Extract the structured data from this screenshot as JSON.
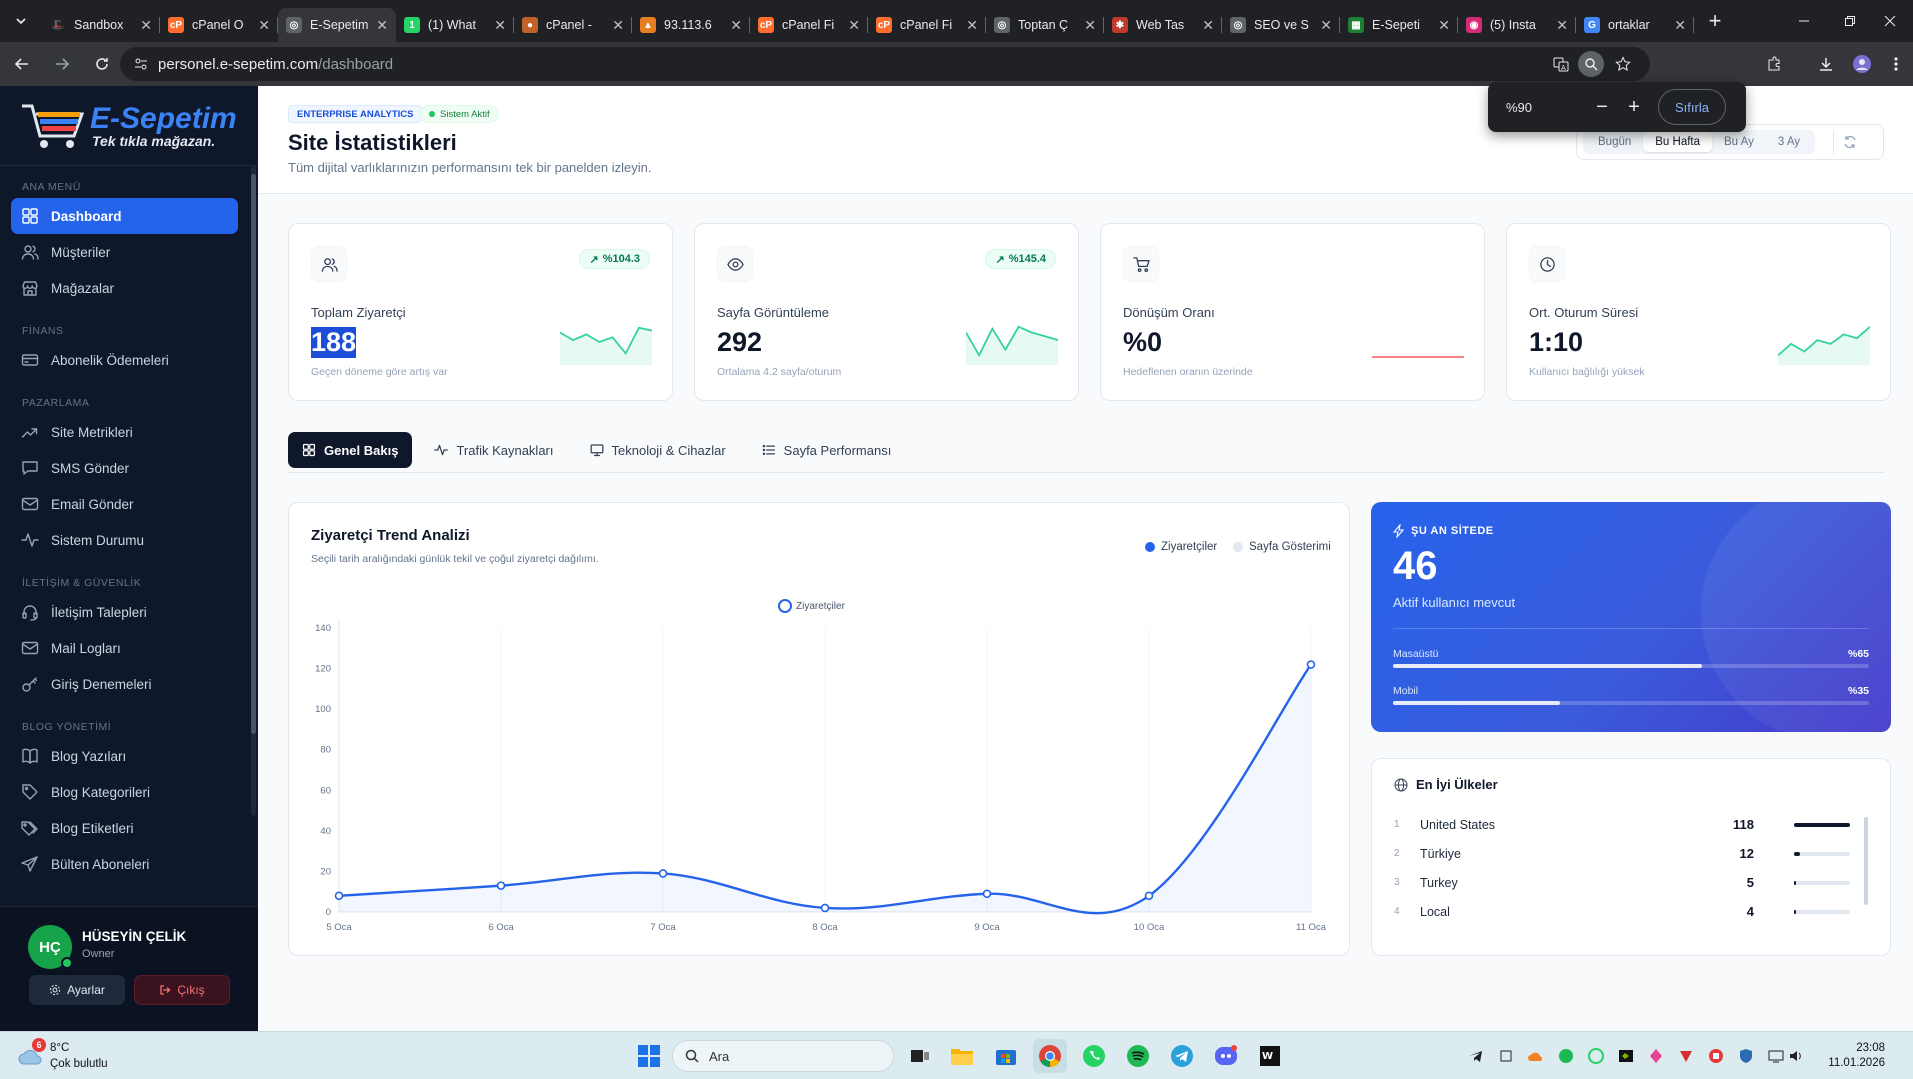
{
  "browser": {
    "tabs": [
      {
        "title": "Sandbox",
        "fav_color": "#202124",
        "fav_text": "🎩"
      },
      {
        "title": "cPanel O",
        "fav_color": "#ff6c2c",
        "fav_text": "cP"
      },
      {
        "title": "E-Sepetim",
        "fav_color": "#5f6368",
        "fav_text": "◎",
        "active": true
      },
      {
        "title": "(1) What",
        "fav_color": "#25d366",
        "fav_text": "1"
      },
      {
        "title": "cPanel -",
        "fav_color": "#c0632a",
        "fav_text": "●"
      },
      {
        "title": "93.113.6",
        "fav_color": "#e67e22",
        "fav_text": "▲"
      },
      {
        "title": "cPanel Fi",
        "fav_color": "#ff6c2c",
        "fav_text": "cP"
      },
      {
        "title": "cPanel Fi",
        "fav_color": "#ff6c2c",
        "fav_text": "cP"
      },
      {
        "title": "Toptan Ç",
        "fav_color": "#5f6368",
        "fav_text": "◎"
      },
      {
        "title": "Web Tas",
        "fav_color": "#c0392b",
        "fav_text": "✱"
      },
      {
        "title": "SEO ve S",
        "fav_color": "#5f6368",
        "fav_text": "◎"
      },
      {
        "title": "E-Sepeti",
        "fav_color": "#1e7e34",
        "fav_text": "▦"
      },
      {
        "title": "(5) Insta",
        "fav_color": "#d62976",
        "fav_text": "◉"
      },
      {
        "title": "ortaklar",
        "fav_color": "#4285f4",
        "fav_text": "G"
      }
    ],
    "url_host": "personel.e-sepetim.com",
    "url_path": "/dashboard",
    "zoom": {
      "value": "%90",
      "reset_label": "Sıfırla"
    }
  },
  "sidebar": {
    "brand": "E-Sepetim",
    "tagline": "Tek tıkla mağazan.",
    "sections": [
      {
        "title": "ANA MENÜ",
        "items": [
          {
            "label": "Dashboard",
            "icon": "grid-icon",
            "active": true
          },
          {
            "label": "Müşteriler",
            "icon": "users-icon"
          },
          {
            "label": "Mağazalar",
            "icon": "store-icon"
          }
        ]
      },
      {
        "title": "FİNANS",
        "items": [
          {
            "label": "Abonelik Ödemeleri",
            "icon": "card-icon"
          }
        ]
      },
      {
        "title": "PAZARLAMA",
        "items": [
          {
            "label": "Site Metrikleri",
            "icon": "trend-icon"
          },
          {
            "label": "SMS Gönder",
            "icon": "message-icon"
          },
          {
            "label": "Email Gönder",
            "icon": "mail-icon"
          },
          {
            "label": "Sistem Durumu",
            "icon": "pulse-icon"
          }
        ]
      },
      {
        "title": "İLETİŞİM & GÜVENLİK",
        "items": [
          {
            "label": "İletişim Talepleri",
            "icon": "headset-icon"
          },
          {
            "label": "Mail Logları",
            "icon": "mail-icon"
          },
          {
            "label": "Giriş Denemeleri",
            "icon": "key-icon"
          }
        ]
      },
      {
        "title": "BLOG YÖNETİMİ",
        "items": [
          {
            "label": "Blog Yazıları",
            "icon": "book-icon"
          },
          {
            "label": "Blog Kategorileri",
            "icon": "tag-icon"
          },
          {
            "label": "Blog Etiketleri",
            "icon": "tags-icon"
          },
          {
            "label": "Bülten Aboneleri",
            "icon": "send-icon"
          }
        ]
      }
    ],
    "user": {
      "initials": "HÇ",
      "name": "HÜSEYİN ÇELİK",
      "role": "Owner",
      "settings_label": "Ayarlar",
      "logout_label": "Çıkış"
    }
  },
  "header": {
    "badge": "ENTERPRISE ANALYTICS",
    "status": "Sistem Aktif",
    "title": "Site İstatistikleri",
    "subtitle": "Tüm dijital varlıklarınızın performansını tek bir panelden izleyin.",
    "ranges": [
      "Bugün",
      "Bu Hafta",
      "Bu Ay",
      "3 Ay"
    ],
    "active_range": "Bu Hafta"
  },
  "stats": [
    {
      "label": "Toplam Ziyaretçi",
      "value": "188",
      "note": "Geçen döneme göre artış var",
      "delta": "%104.3",
      "icon": "users-icon",
      "spark": [
        30,
        22,
        28,
        20,
        25,
        8,
        35,
        32
      ],
      "spark_color": "#34d399"
    },
    {
      "label": "Sayfa Görüntüleme",
      "value": "292",
      "note": "Ortalama 4.2 sayfa/oturum",
      "delta": "%145.4",
      "icon": "eye-icon",
      "spark": [
        30,
        6,
        34,
        12,
        36,
        30,
        26,
        22
      ],
      "spark_color": "#34d399"
    },
    {
      "label": "Dönüşüm Oranı",
      "value": "%0",
      "note": "Hedeflenen oranın üzerinde",
      "delta": "",
      "icon": "cart-icon",
      "spark": [
        0,
        0,
        0,
        0,
        0,
        0,
        0,
        0
      ],
      "spark_color": "#f87171"
    },
    {
      "label": "Ort. Oturum Süresi",
      "value": "1:10",
      "note": "Kullanıcı bağlılığı yüksek",
      "delta": "",
      "icon": "clock-icon",
      "spark": [
        6,
        18,
        10,
        22,
        18,
        28,
        24,
        36
      ],
      "spark_color": "#34d399"
    }
  ],
  "tabs": [
    {
      "label": "Genel Bakış",
      "icon": "grid-icon",
      "active": true
    },
    {
      "label": "Trafik Kaynakları",
      "icon": "pulse-icon"
    },
    {
      "label": "Teknoloji & Cihazlar",
      "icon": "monitor-icon"
    },
    {
      "label": "Sayfa Performansı",
      "icon": "list-icon"
    }
  ],
  "trend": {
    "title": "Ziyaretçi Trend Analizi",
    "subtitle": "Seçili tarih aralığındaki günlük tekil ve çoğul ziyaretçi dağılımı.",
    "legend": [
      {
        "name": "Ziyaretçiler",
        "color": "#2563eb"
      },
      {
        "name": "Sayfa Gösterimi",
        "color": "#e2e8f0"
      }
    ]
  },
  "chart_data": {
    "type": "line",
    "x": [
      "5 Oca",
      "6 Oca",
      "7 Oca",
      "8 Oca",
      "9 Oca",
      "10 Oca",
      "11 Oca"
    ],
    "series": [
      {
        "name": "Ziyaretçiler",
        "values": [
          8,
          13,
          19,
          2,
          9,
          8,
          122
        ]
      }
    ],
    "ylim": [
      0,
      140
    ],
    "yticks": [
      0,
      20,
      40,
      60,
      80,
      100,
      120,
      140
    ],
    "grid": "vertical",
    "legend": "top-center"
  },
  "live": {
    "label": "ŞU AN SİTEDE",
    "count": "46",
    "subtitle": "Aktif kullanıcı mevcut",
    "devices": [
      {
        "name": "Masaüstü",
        "percent_label": "%65",
        "percent": 65
      },
      {
        "name": "Mobil",
        "percent_label": "%35",
        "percent": 35
      }
    ]
  },
  "countries": {
    "title": "En İyi Ülkeler",
    "rows": [
      {
        "rank": "1",
        "name": "United States",
        "value": "118",
        "ratio": 1.0
      },
      {
        "rank": "2",
        "name": "Türkiye",
        "value": "12",
        "ratio": 0.1
      },
      {
        "rank": "3",
        "name": "Turkey",
        "value": "5",
        "ratio": 0.04
      },
      {
        "rank": "4",
        "name": "Local",
        "value": "4",
        "ratio": 0.03
      }
    ]
  },
  "taskbar": {
    "weather_badge": "6",
    "temp": "8°C",
    "weather": "Çok bulutlu",
    "search_placeholder": "Ara",
    "time": "23:08",
    "date": "11.01.2026"
  }
}
